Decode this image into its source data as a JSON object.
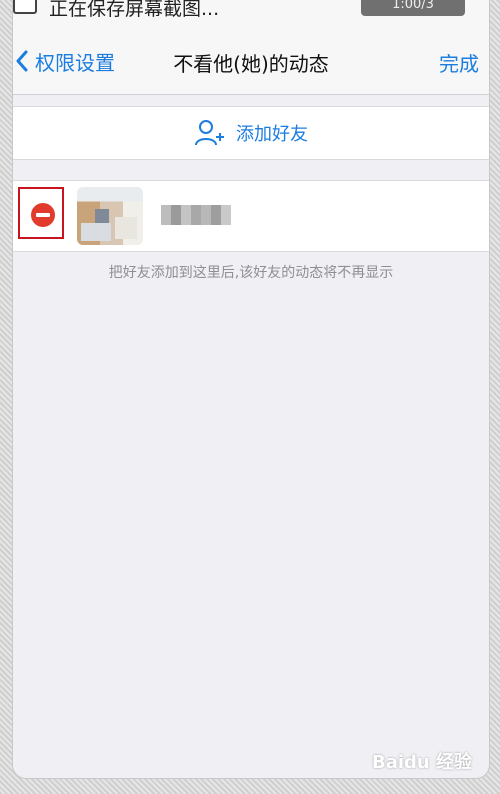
{
  "status_bar": {
    "notification_text": "正在保存屏幕截图...",
    "pill_text": "1:00/3"
  },
  "nav": {
    "back_label": "权限设置",
    "title": "不看他(她)的动态",
    "done_label": "完成"
  },
  "add_friend": {
    "label": "添加好友",
    "icon": "add-user-icon"
  },
  "friends": [
    {
      "name": "",
      "avatar": "blurred-photo",
      "remove_icon": "minus-circle-icon"
    }
  ],
  "hint": "把好友添加到这里后,该好友的动态将不再显示",
  "watermark": "Baidu 经验",
  "colors": {
    "accent": "#1c7de0",
    "remove": "#e13b2e",
    "highlight_box": "#c8141e",
    "background": "#efeff4"
  }
}
